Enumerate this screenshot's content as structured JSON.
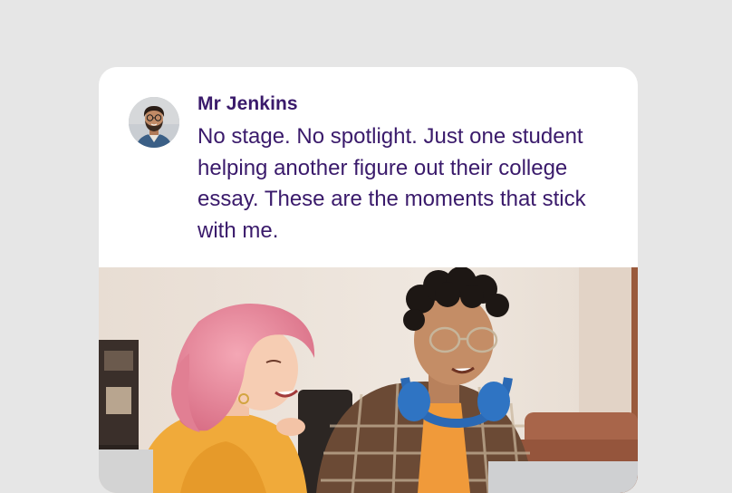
{
  "post": {
    "author": "Mr Jenkins",
    "message": "No stage. No spotlight. Just one student helping another figure out their college essay. These are the moments that stick with me."
  },
  "colors": {
    "background": "#e6e6e6",
    "card": "#ffffff",
    "text": "#3a1a6b"
  }
}
